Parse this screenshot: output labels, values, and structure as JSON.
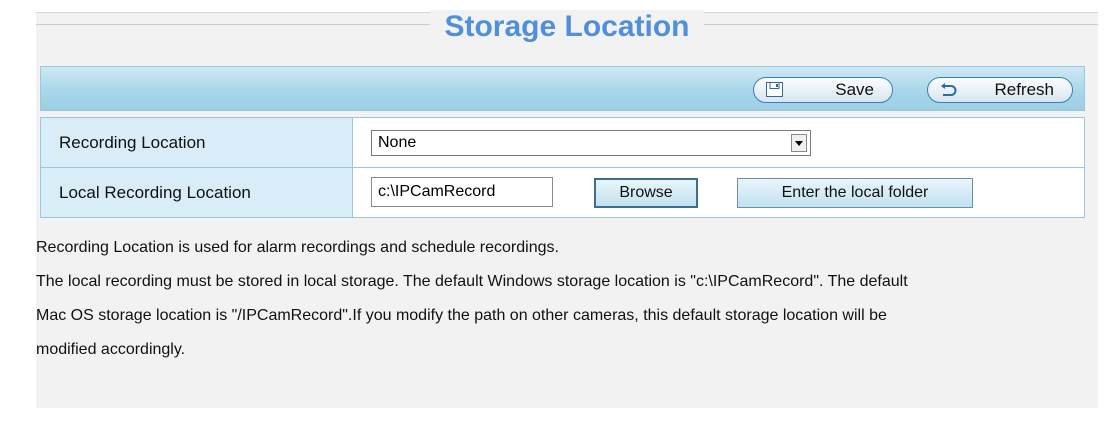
{
  "page": {
    "title": "Storage Location"
  },
  "toolbar": {
    "save_label": "Save",
    "refresh_label": "Refresh"
  },
  "form": {
    "recording_location": {
      "label": "Recording Location",
      "selected": "None"
    },
    "local_recording_location": {
      "label": "Local Recording Location",
      "value": "c:\\IPCamRecord",
      "browse_label": "Browse",
      "enter_folder_label": "Enter the local folder"
    }
  },
  "description": {
    "line1": "Recording Location is used for alarm recordings and schedule recordings.",
    "line2": "The local recording must be stored in local storage. The default Windows storage location is \"c:\\IPCamRecord\". The default",
    "line3": "Mac OS storage location is \"/IPCamRecord\".If you modify the path on other cameras, this default storage location will be",
    "line4": "modified accordingly."
  },
  "colors": {
    "title": "#4f8fdb",
    "toolbar": "#a9d6ea",
    "label_cell": "#d8edf7",
    "panel": "#f2f2f2"
  },
  "icons": {
    "save": "floppy-disk-icon",
    "refresh": "refresh-arrow-icon",
    "dropdown": "chevron-down-icon"
  }
}
